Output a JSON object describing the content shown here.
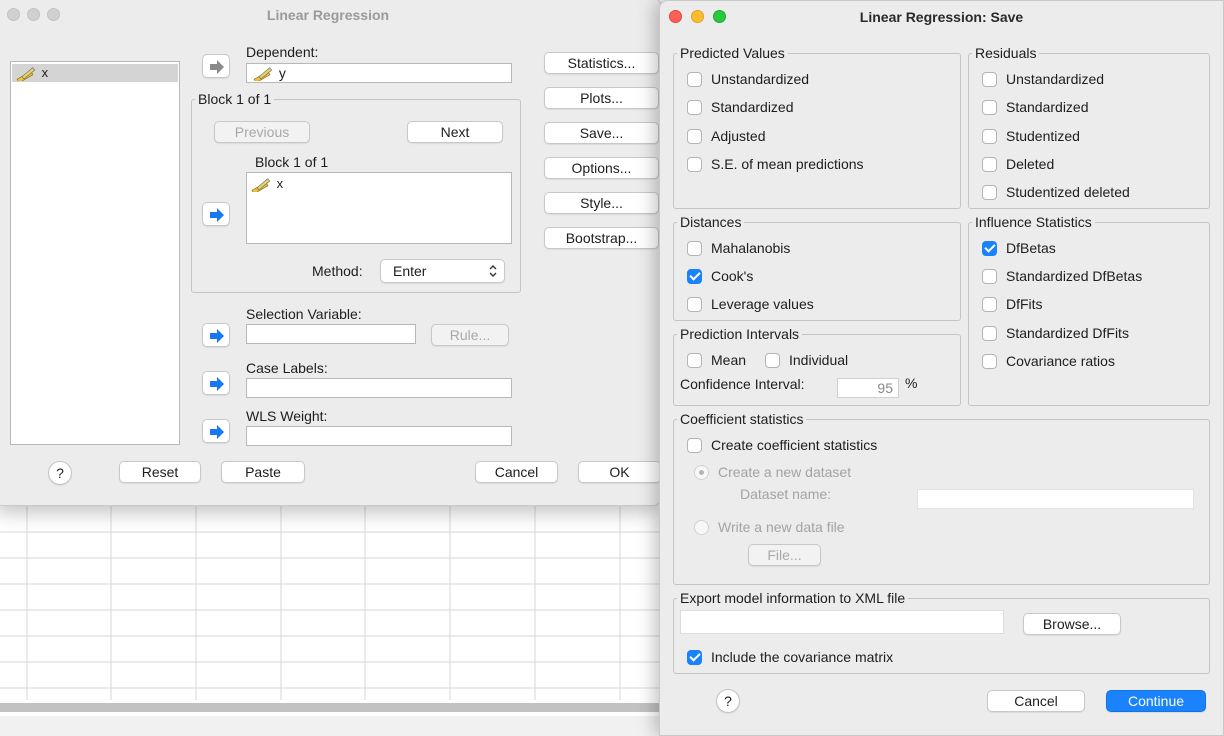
{
  "main_dialog": {
    "title": "Linear Regression",
    "source_list": [
      {
        "name": "x"
      }
    ],
    "dependent": {
      "label": "Dependent:",
      "value": "y"
    },
    "block": {
      "group_title": "Block 1 of 1",
      "previous_label": "Previous",
      "next_label": "Next",
      "inner_label": "Block 1 of 1",
      "independents": [
        "x"
      ],
      "method_label": "Method:",
      "method_value": "Enter"
    },
    "selection_variable": {
      "label": "Selection Variable:",
      "value": "",
      "rule_label": "Rule..."
    },
    "case_labels": {
      "label": "Case Labels:",
      "value": ""
    },
    "wls_weight": {
      "label": "WLS Weight:",
      "value": ""
    },
    "side_buttons": {
      "statistics": "Statistics...",
      "plots": "Plots...",
      "save": "Save...",
      "options": "Options...",
      "style": "Style...",
      "bootstrap": "Bootstrap..."
    },
    "footer": {
      "help": "?",
      "reset": "Reset",
      "paste": "Paste",
      "cancel": "Cancel",
      "ok": "OK"
    }
  },
  "save_dialog": {
    "title": "Linear Regression: Save",
    "predicted_values": {
      "title": "Predicted Values",
      "items": [
        {
          "label": "Unstandardized",
          "checked": false
        },
        {
          "label": "Standardized",
          "checked": false
        },
        {
          "label": "Adjusted",
          "checked": false
        },
        {
          "label": "S.E. of mean predictions",
          "checked": false
        }
      ]
    },
    "residuals": {
      "title": "Residuals",
      "items": [
        {
          "label": "Unstandardized",
          "checked": false
        },
        {
          "label": "Standardized",
          "checked": false
        },
        {
          "label": "Studentized",
          "checked": false
        },
        {
          "label": "Deleted",
          "checked": false
        },
        {
          "label": "Studentized deleted",
          "checked": false
        }
      ]
    },
    "distances": {
      "title": "Distances",
      "items": [
        {
          "label": "Mahalanobis",
          "checked": false
        },
        {
          "label": "Cook's",
          "checked": true
        },
        {
          "label": "Leverage values",
          "checked": false
        }
      ]
    },
    "influence_statistics": {
      "title": "Influence Statistics",
      "items": [
        {
          "label": "DfBetas",
          "checked": true
        },
        {
          "label": "Standardized DfBetas",
          "checked": false
        },
        {
          "label": "DfFits",
          "checked": false
        },
        {
          "label": "Standardized DfFits",
          "checked": false
        },
        {
          "label": "Covariance ratios",
          "checked": false
        }
      ]
    },
    "prediction_intervals": {
      "title": "Prediction Intervals",
      "mean_label": "Mean",
      "mean_checked": false,
      "individual_label": "Individual",
      "individual_checked": false,
      "confidence_label": "Confidence Interval:",
      "confidence_value": "95",
      "percent_sign": "%"
    },
    "coefficient_statistics": {
      "title": "Coefficient statistics",
      "create_label": "Create coefficient statistics",
      "create_checked": false,
      "new_dataset_label": "Create a new dataset",
      "dataset_name_label": "Dataset name:",
      "dataset_name_value": "",
      "write_file_label": "Write a new data file",
      "file_button": "File..."
    },
    "export": {
      "title": "Export model information to XML file",
      "path_value": "",
      "browse_button": "Browse...",
      "include_cov_label": "Include the covariance matrix",
      "include_cov_checked": true
    },
    "footer": {
      "help": "?",
      "cancel": "Cancel",
      "continue": "Continue"
    }
  },
  "colors": {
    "accent": "#1a82fb",
    "arrow_blue": "#1877f2",
    "window_bg": "#ececec"
  },
  "icons": {
    "scale_variable": "ruler-pencil-icon",
    "move_arrow": "right-arrow-icon"
  }
}
